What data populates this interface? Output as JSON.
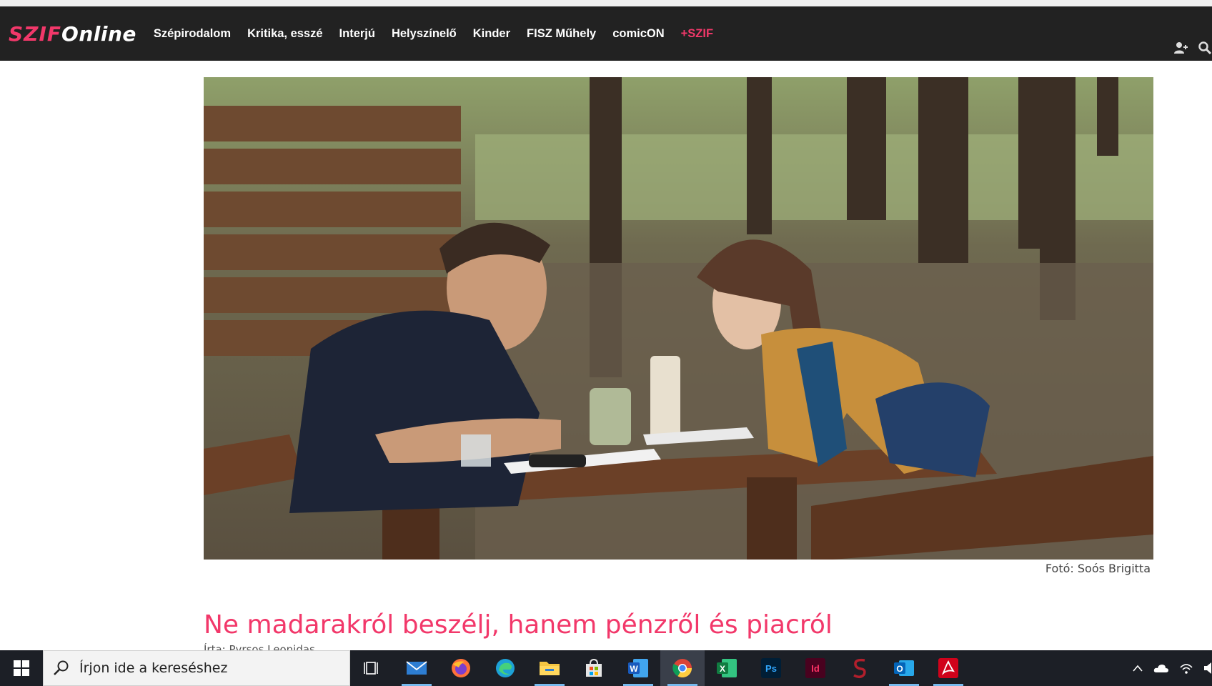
{
  "logo": {
    "part1": "SZIF",
    "part2": "Online"
  },
  "nav": {
    "items": [
      {
        "label": "Szépirodalom"
      },
      {
        "label": "Kritika, esszé"
      },
      {
        "label": "Interjú"
      },
      {
        "label": "Helyszínelő"
      },
      {
        "label": "Kinder"
      },
      {
        "label": "FISZ Műhely"
      },
      {
        "label": "comicON"
      },
      {
        "label": "+SZIF"
      }
    ],
    "icons": [
      "user-add-icon",
      "search-icon"
    ]
  },
  "article": {
    "image_caption": "Fotó: Soós Brigitta",
    "title": "Ne madarakról beszélj, hanem pénzről és piacról",
    "author_line": "Írta: Pyrsos Leonidas"
  },
  "taskbar": {
    "search_placeholder": "Írjon ide a kereséshez",
    "apps": [
      "task-view-icon",
      "mail-icon",
      "firefox-icon",
      "edge-icon",
      "file-explorer-icon",
      "store-icon",
      "word-icon",
      "chrome-icon",
      "excel-icon",
      "photoshop-icon",
      "indesign-icon",
      "app-s-icon",
      "outlook-icon",
      "acrobat-icon"
    ],
    "ps_label": "Ps",
    "id_label": "Id",
    "w_label": "W",
    "x_label": "X",
    "o_label": "O"
  },
  "colors": {
    "accent": "#f2386a",
    "navbar": "#222222",
    "taskbar": "#1c1f26"
  }
}
